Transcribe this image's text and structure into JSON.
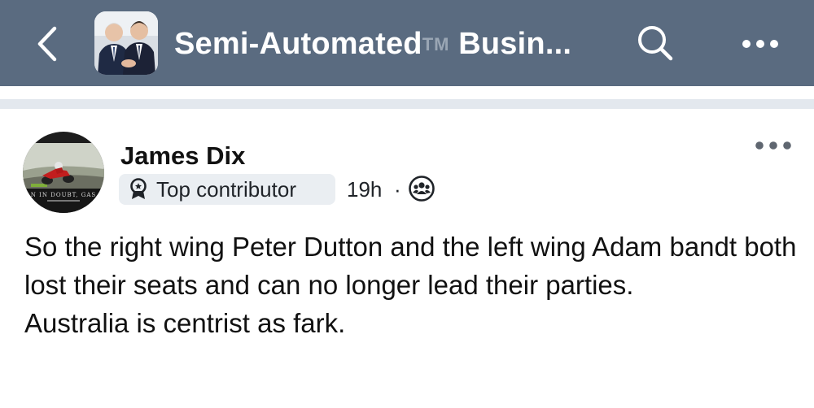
{
  "header": {
    "back_icon": "chevron-left-icon",
    "group_name": "Semi-Automated",
    "group_tm": "TM",
    "group_name_rest": " Busin...",
    "search_icon": "search-icon",
    "more_icon": "more-horizontal-icon"
  },
  "post": {
    "author": "James Dix",
    "avatar_caption": "N IN DOUBT, GAS",
    "badge_label": "Top contributor",
    "timestamp": "19h",
    "separator": "·",
    "audience_icon": "community-icon",
    "body_lines": [
      "So the right wing Peter Dutton and the left wing Adam bandt both lost their seats and can no longer lead their parties.",
      "Australia is centrist as fark."
    ]
  },
  "colors": {
    "header_bg": "#5a6b80",
    "divider_band": "#e3e8ee",
    "badge_bg": "#eaeef2",
    "text": "#111111"
  }
}
